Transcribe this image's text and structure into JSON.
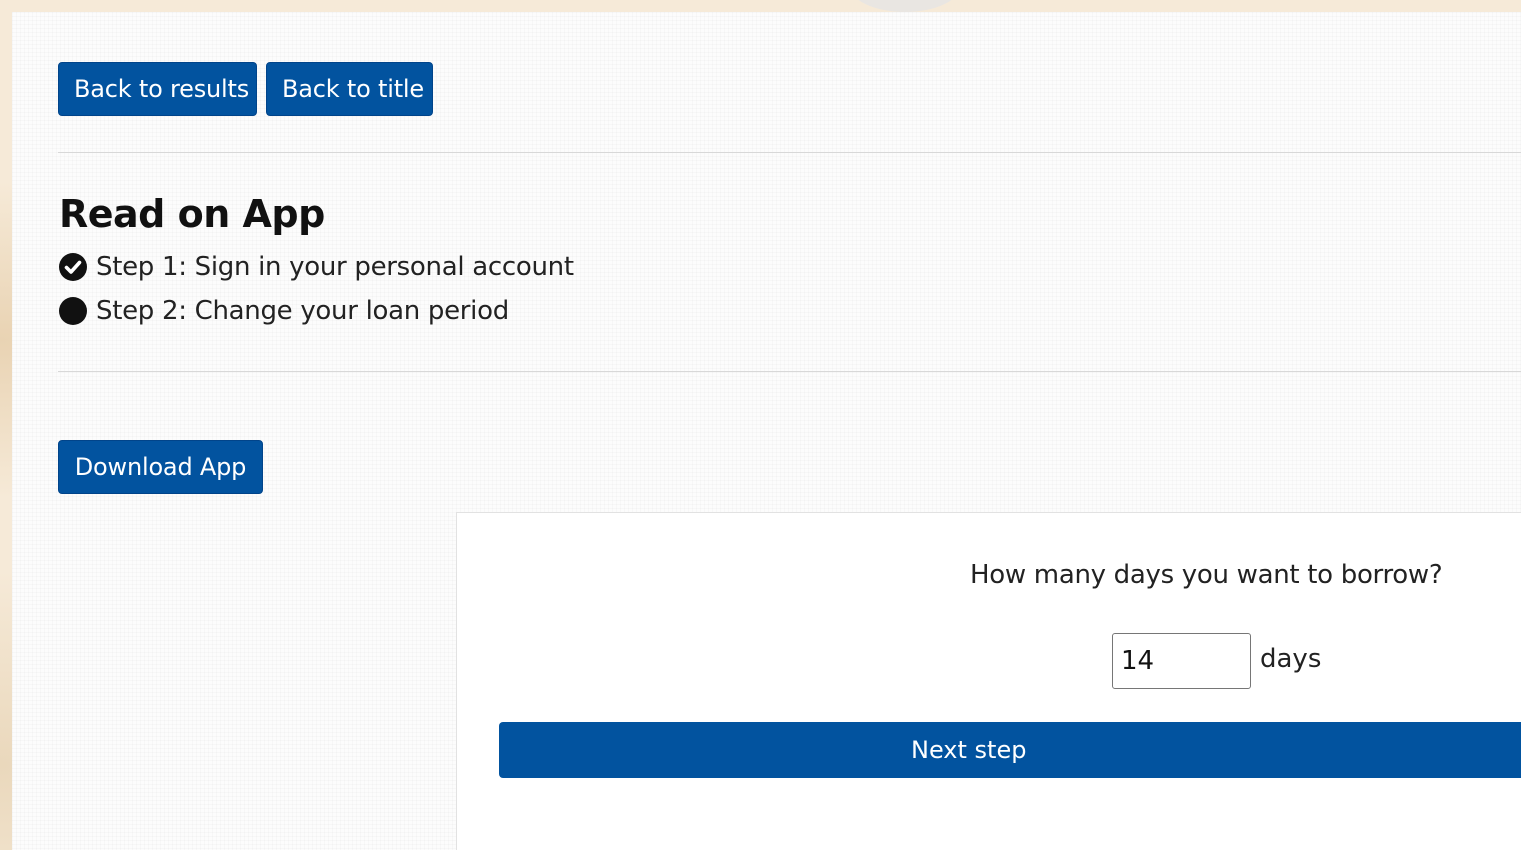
{
  "nav": {
    "back_to_results": "Back to results",
    "back_to_title": "Back to title"
  },
  "main": {
    "title": "Read on App",
    "steps": [
      {
        "label": "Step 1: Sign in your personal account",
        "status": "check-circle-icon"
      },
      {
        "label": "Step 2: Change your loan period",
        "status": "filled-circle-icon"
      }
    ],
    "download_label": "Download App"
  },
  "loan_form": {
    "question": "How many days you want to borrow?",
    "days_value": "14",
    "days_unit": "days",
    "next_label": "Next step"
  },
  "colors": {
    "primary": "#02539f",
    "background": "#f6ead8"
  }
}
